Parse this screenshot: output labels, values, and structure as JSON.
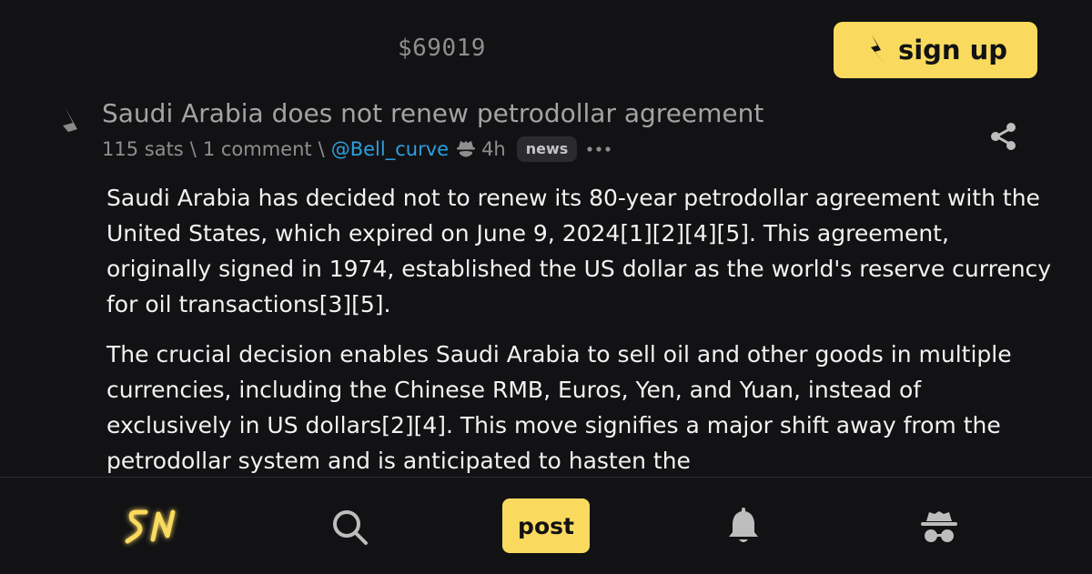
{
  "header": {
    "price": "$69019",
    "signup_label": "sign up"
  },
  "post": {
    "title": "Saudi Arabia does not renew petrodollar agreement",
    "sats": "115 sats",
    "separator": "\\",
    "comments": "1 comment",
    "user": "@Bell_curve",
    "age": "4h",
    "badge": "news",
    "paragraphs": [
      "Saudi Arabia has decided not to renew its 80-year petrodollar agreement with the United States, which expired on June 9, 2024[1][2][4][5]. This agreement, originally signed in 1974, established the US dollar as the world's reserve currency for oil transactions[3][5].",
      "The crucial decision enables Saudi Arabia to sell oil and other goods in multiple currencies, including the Chinese RMB, Euros, Yen, and Yuan, instead of exclusively in US dollars[2][4]. This move signifies a major shift away from the petrodollar system and is anticipated to hasten the"
    ]
  },
  "bottom_nav": {
    "post_label": "post"
  },
  "colors": {
    "background": "#121214",
    "accent": "#fada5e",
    "link": "#2ca0e0",
    "muted": "#8e8e8e"
  },
  "icons": [
    "bolt-icon",
    "share-icon",
    "more-icon",
    "anon-hat-icon",
    "search-icon",
    "bell-icon",
    "anon-icon",
    "sn-logo"
  ]
}
